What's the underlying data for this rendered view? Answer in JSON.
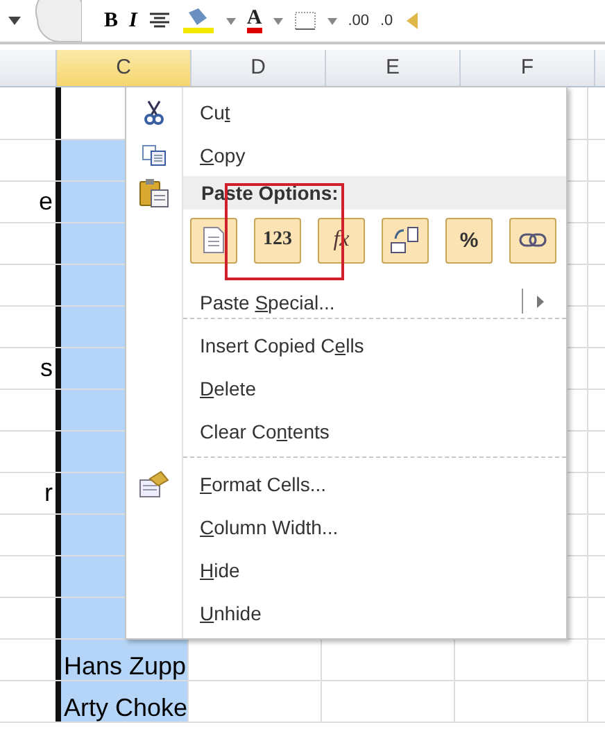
{
  "toolbar": {
    "bold": "B",
    "italic": "I",
    "font_color": "A",
    "increase_decimal": ".00",
    "decrease_decimal": ".0"
  },
  "columns": [
    {
      "label": "C",
      "selected": true
    },
    {
      "label": "D",
      "selected": false
    },
    {
      "label": "E",
      "selected": false
    },
    {
      "label": "F",
      "selected": false
    }
  ],
  "rows": [
    {
      "active": true
    },
    {
      "active": false
    },
    {
      "active": false,
      "left_text": "e"
    },
    {
      "active": false
    },
    {
      "active": false
    },
    {
      "active": false
    },
    {
      "active": false,
      "left_text": "s"
    },
    {
      "active": false
    },
    {
      "active": false
    },
    {
      "active": false,
      "left_text": "r"
    },
    {
      "active": false
    },
    {
      "active": false
    },
    {
      "active": false
    },
    {
      "active": false,
      "c_text": "Hans Zupp"
    },
    {
      "active": false,
      "c_text": "Arty Choke"
    }
  ],
  "context_menu": {
    "items": [
      {
        "kind": "item",
        "label": {
          "before": "Cu",
          "key": "t"
        }
      },
      {
        "kind": "item",
        "label": {
          "key": "C",
          "after": "opy"
        }
      },
      {
        "kind": "header",
        "text": "Paste Options:"
      },
      {
        "kind": "paste_row",
        "buttons": [
          {
            "kind": "paste"
          },
          {
            "kind": "values",
            "text": "123"
          },
          {
            "kind": "formulas",
            "text": "fx"
          },
          {
            "kind": "transpose"
          },
          {
            "kind": "formatting",
            "text": "%"
          },
          {
            "kind": "link"
          }
        ]
      },
      {
        "kind": "item",
        "label": {
          "before": "Paste ",
          "key": "S",
          "after": "pecial..."
        },
        "submenu": true
      },
      {
        "kind": "separator"
      },
      {
        "kind": "item",
        "label": {
          "before": "Insert Copied C",
          "key": "e",
          "after": "lls"
        }
      },
      {
        "kind": "item",
        "label": {
          "key": "D",
          "after": "elete"
        }
      },
      {
        "kind": "item",
        "label": {
          "before": "Clear Co",
          "key": "n",
          "after": "tents"
        }
      },
      {
        "kind": "separator"
      },
      {
        "kind": "item",
        "label": {
          "key": "F",
          "after": "ormat Cells..."
        }
      },
      {
        "kind": "item",
        "label": {
          "key": "C",
          "after": "olumn Width..."
        }
      },
      {
        "kind": "item",
        "label": {
          "key": "H",
          "after": "ide"
        }
      },
      {
        "kind": "item",
        "label": {
          "key": "U",
          "after": "nhide"
        }
      }
    ]
  }
}
